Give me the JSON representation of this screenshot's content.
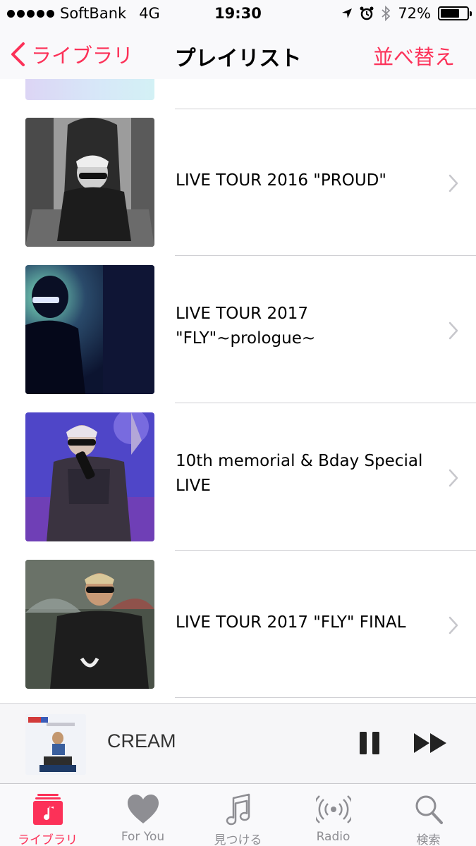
{
  "status_bar": {
    "carrier": "SoftBank",
    "network": "4G",
    "time": "19:30",
    "battery": "72%",
    "battery_level": 0.72
  },
  "nav": {
    "back_label": "ライブラリ",
    "title": "プレイリスト",
    "sort_label": "並べ替え"
  },
  "playlists": [
    {
      "title": "LIVE TOUR 2016 \"PROUD\""
    },
    {
      "title": "LIVE TOUR 2017\n\"FLY\"~prologue~"
    },
    {
      "title": "10th memorial & Bday Special LIVE"
    },
    {
      "title": "LIVE TOUR 2017 \"FLY\" FINAL"
    }
  ],
  "mini_player": {
    "track_title": "CREAM"
  },
  "tabs": [
    {
      "label": "ライブラリ",
      "icon": "library-icon",
      "active": true
    },
    {
      "label": "For You",
      "icon": "heart-icon",
      "active": false
    },
    {
      "label": "見つける",
      "icon": "music-note-icon",
      "active": false
    },
    {
      "label": "Radio",
      "icon": "radio-icon",
      "active": false
    },
    {
      "label": "検索",
      "icon": "search-icon",
      "active": false
    }
  ],
  "colors": {
    "accent": "#fc3158",
    "inactive": "#8e8e93"
  }
}
